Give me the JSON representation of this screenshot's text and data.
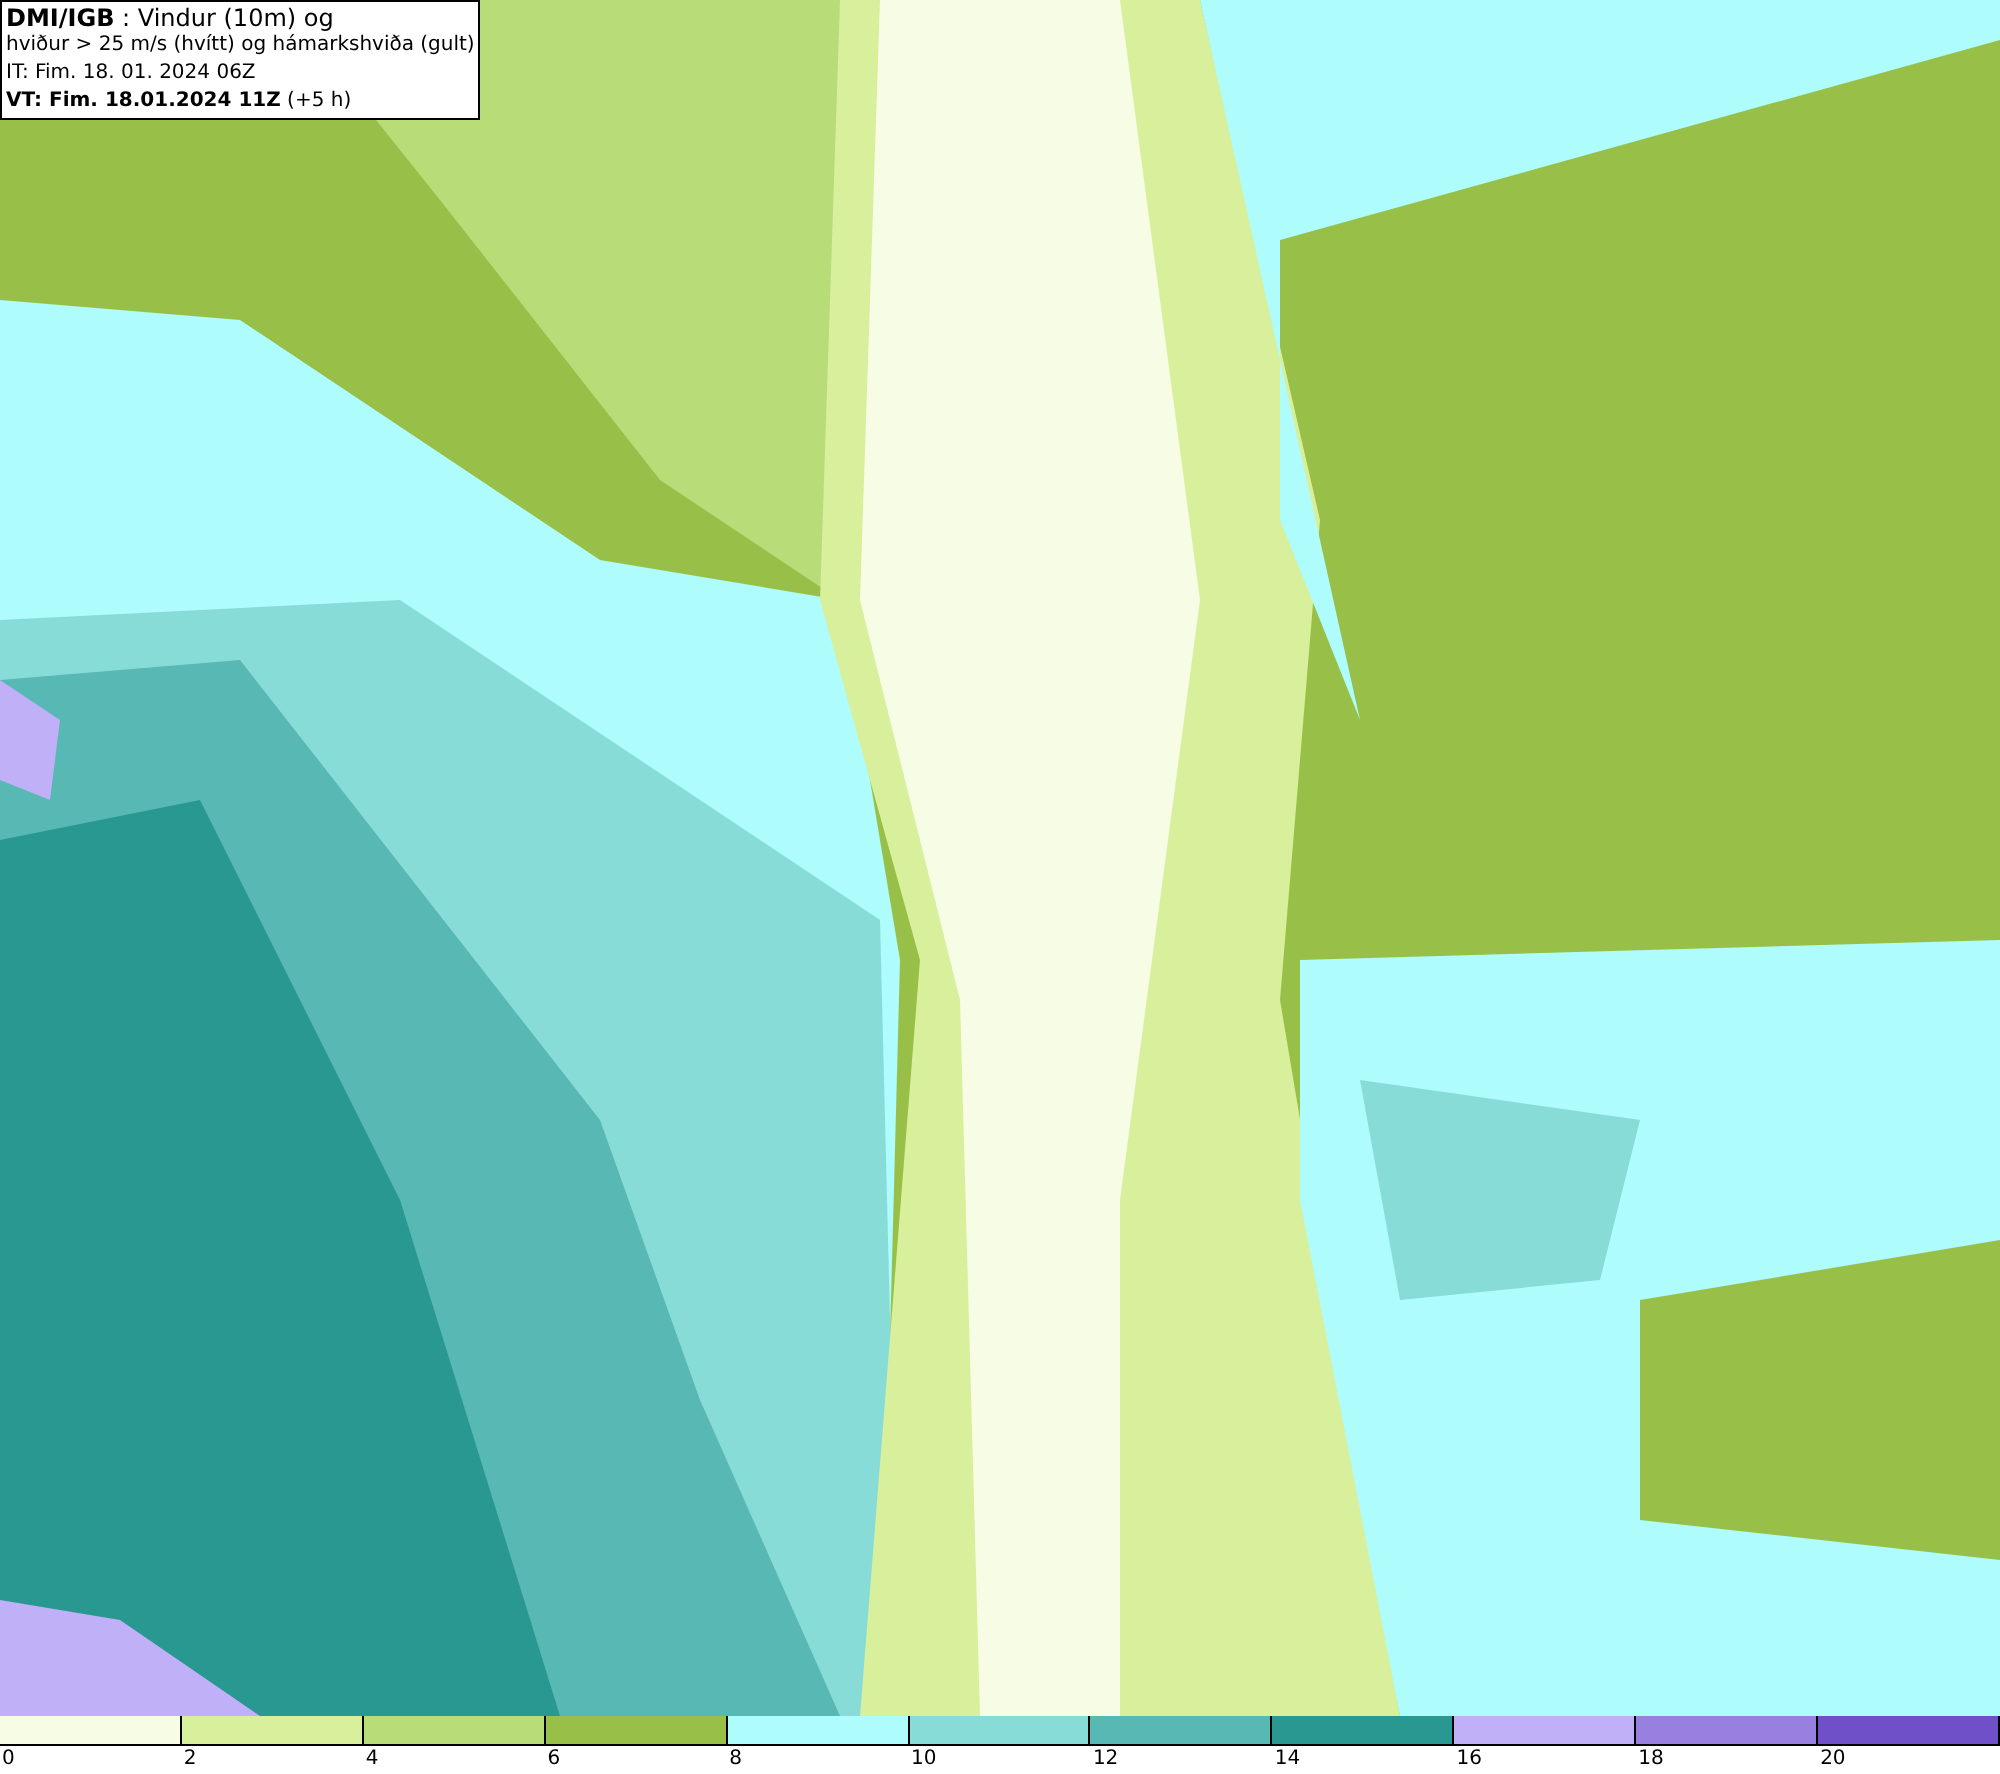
{
  "legend": {
    "lines": [
      "**DMI/IGB** : Vindur (10m) og",
      "hviður > 25 m/s (hvítt) og hámarkshviða (gult)",
      "IT: Fim. 18. 01. 2024 06Z",
      "**VT: Fim. 18.01.2024 11Z** (+5 h)"
    ]
  },
  "colorbar": [
    {
      "label": "0",
      "color": "#f7fde4"
    },
    {
      "label": "2",
      "color": "#d8ef9c"
    },
    {
      "label": "4",
      "color": "#b8dc78"
    },
    {
      "label": "6",
      "color": "#98c048"
    },
    {
      "label": "8",
      "color": "#aefcfc"
    },
    {
      "label": "10",
      "color": "#88dcd8"
    },
    {
      "label": "12",
      "color": "#58b8b4"
    },
    {
      "label": "14",
      "color": "#289890"
    },
    {
      "label": "16",
      "color": "#c0b0f8"
    },
    {
      "label": "18",
      "color": "#9880e0"
    },
    {
      "label": "20",
      "color": "#7050c8"
    }
  ]
}
